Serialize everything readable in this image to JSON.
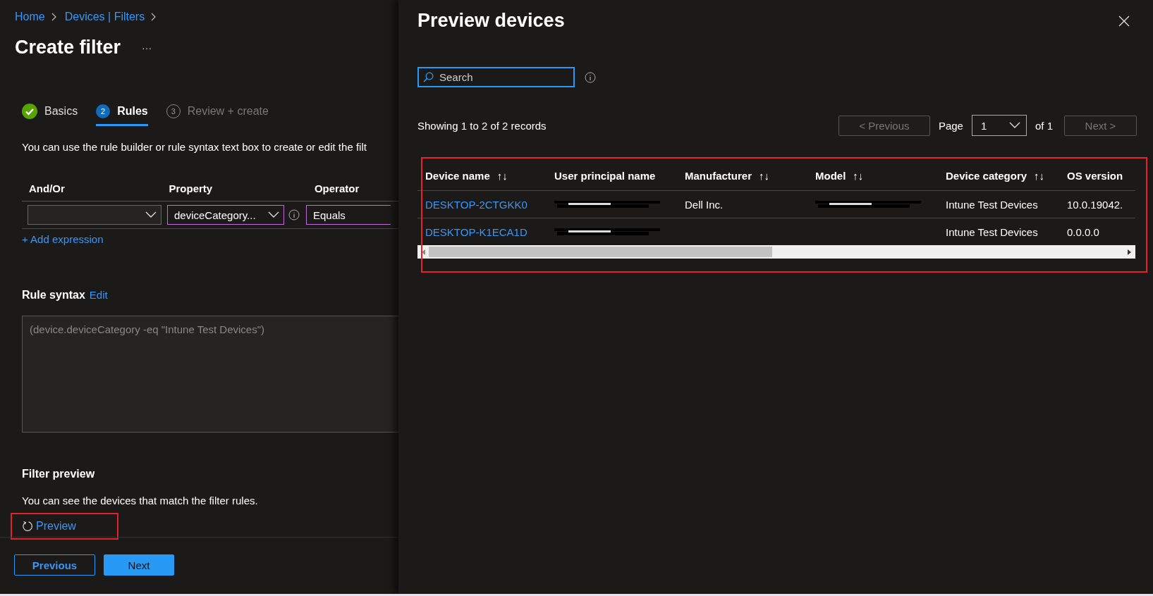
{
  "breadcrumb": [
    {
      "label": "Home"
    },
    {
      "label": "Devices | Filters"
    }
  ],
  "page_title": "Create filter",
  "more_label": "···",
  "steps": [
    {
      "label": "Basics",
      "kind": "done",
      "selected": false
    },
    {
      "number": "2",
      "label": "Rules",
      "kind": "current",
      "selected": true
    },
    {
      "number": "3",
      "label": "Review + create",
      "kind": "pending",
      "selected": false
    }
  ],
  "rules_description": "You can use the rule builder or rule syntax text box to create or edit the filt",
  "rule_table": {
    "columns": [
      "And/Or",
      "Property",
      "Operator"
    ],
    "row": {
      "property": "deviceCategory...",
      "operator": "Equals"
    }
  },
  "add_expression": "+ Add expression",
  "rule_syntax": {
    "label": "Rule syntax",
    "edit_link": "Edit",
    "text": "(device.deviceCategory -eq \"Intune Test Devices\")"
  },
  "filter_preview": {
    "heading": "Filter preview",
    "description": "You can see the devices that match the filter rules.",
    "preview_link": "Preview",
    "highlighted": true
  },
  "footer_buttons": [
    {
      "label": "Previous",
      "kind": "secondary"
    },
    {
      "label": "Next",
      "kind": "primary"
    }
  ],
  "panel": {
    "title": "Preview devices",
    "search": {
      "placeholder": "Search"
    },
    "records": "Showing 1 to 2 of 2 records",
    "pager": {
      "previous": "< Previous",
      "previous_disabled": true,
      "page_label": "Page",
      "page": "1",
      "of": "of 1",
      "next": "Next >",
      "next_disabled": true
    },
    "table": {
      "highlighted": true,
      "columns": [
        {
          "label": "Device name",
          "sort": "↑↓"
        },
        {
          "label": "User principal name"
        },
        {
          "label": "Manufacturer",
          "sort": "↑↓"
        },
        {
          "label": "Model",
          "sort": "↑↓"
        },
        {
          "label": "Device category",
          "sort": "↑↓"
        },
        {
          "label": "OS version"
        }
      ],
      "rows": [
        {
          "cells": [
            {
              "kind": "link",
              "text": "DESKTOP-2CTGKK0"
            },
            {
              "kind": "redacted"
            },
            {
              "kind": "text",
              "text": "Dell Inc."
            },
            {
              "kind": "redacted"
            },
            {
              "kind": "text",
              "text": "Intune Test Devices"
            },
            {
              "kind": "text",
              "text": "10.0.19042."
            }
          ]
        },
        {
          "cells": [
            {
              "kind": "link",
              "text": "DESKTOP-K1ECA1D"
            },
            {
              "kind": "redacted"
            },
            {
              "kind": "empty"
            },
            {
              "kind": "empty"
            },
            {
              "kind": "text",
              "text": "Intune Test Devices"
            },
            {
              "kind": "text",
              "text": "0.0.0.0"
            }
          ]
        }
      ]
    }
  }
}
